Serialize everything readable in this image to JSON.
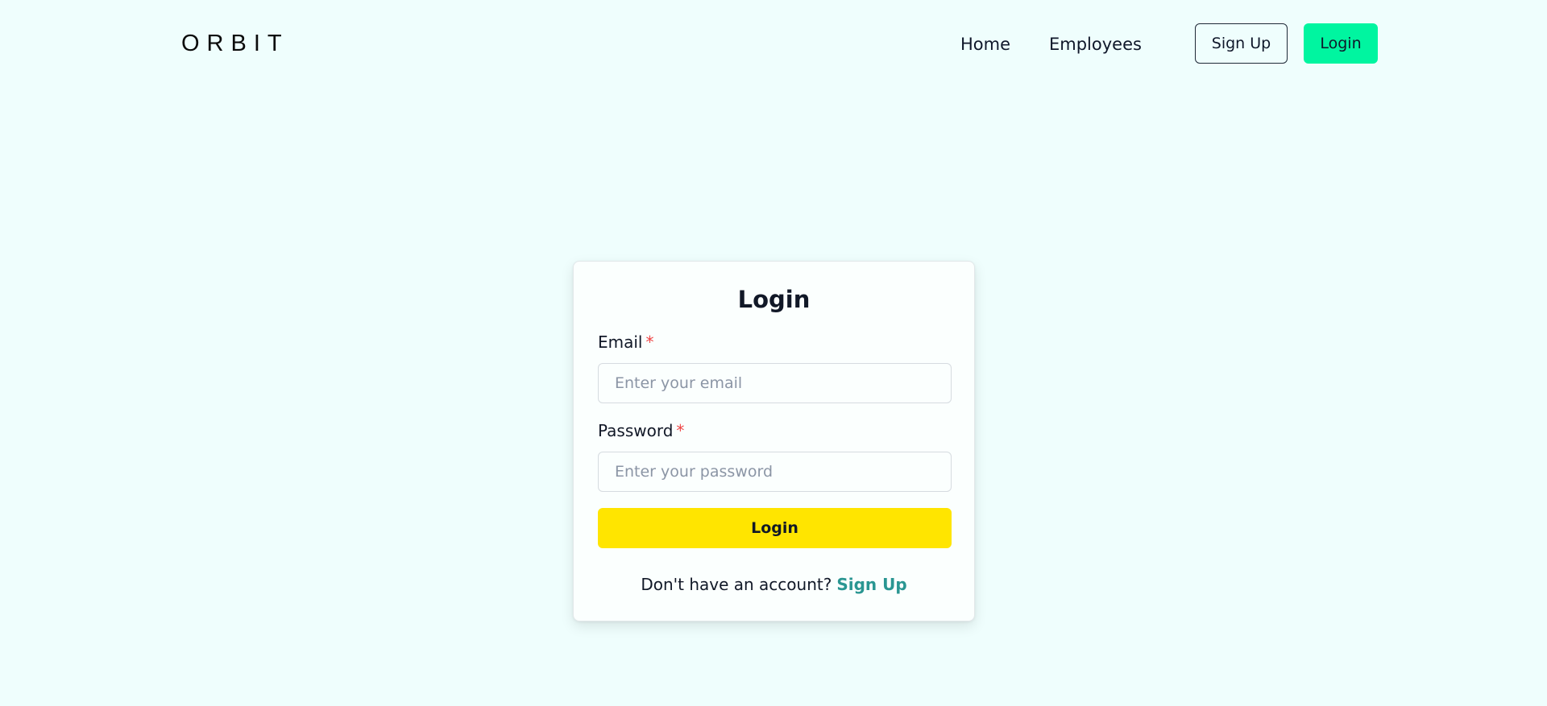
{
  "header": {
    "logo_text": "ORBIT",
    "nav": {
      "home": "Home",
      "employees": "Employees"
    },
    "signup_button": "Sign Up",
    "login_button": "Login"
  },
  "login_card": {
    "title": "Login",
    "email": {
      "label": "Email",
      "required_mark": "*",
      "placeholder": "Enter your email"
    },
    "password": {
      "label": "Password",
      "required_mark": "*",
      "placeholder": "Enter your password"
    },
    "submit_label": "Login",
    "footer_text": "Don't have an account?",
    "footer_link": "Sign Up"
  },
  "colors": {
    "background": "#effefd",
    "login_accent": "#00f5a0",
    "submit_accent": "#ffe500",
    "link_accent": "#2a9692",
    "required_mark": "#ef4444"
  }
}
